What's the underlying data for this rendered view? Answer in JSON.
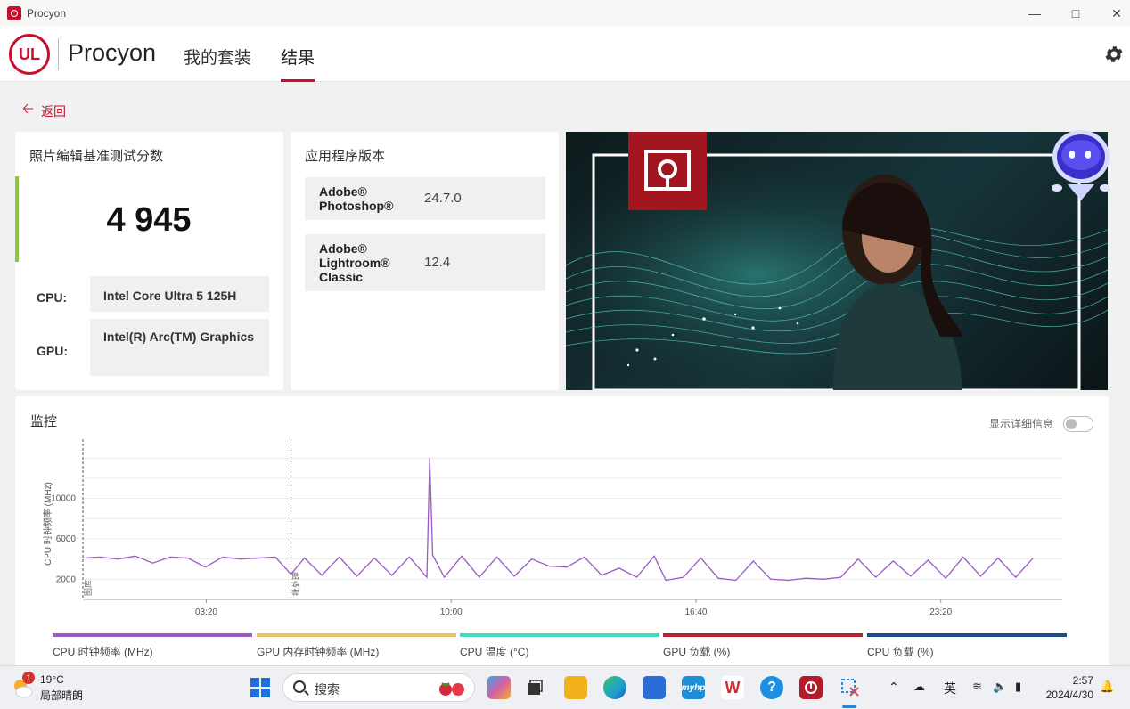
{
  "window": {
    "title": "Procyon"
  },
  "header": {
    "brand": "Procyon",
    "logo_text": "UL",
    "nav": [
      {
        "label": "我的套装",
        "active": false
      },
      {
        "label": "结果",
        "active": true
      }
    ]
  },
  "back_label": "返回",
  "score_card": {
    "title": "照片编辑基准测试分数",
    "score": "4 945",
    "cpu_label": "CPU:",
    "cpu_value": "Intel Core Ultra 5 125H",
    "gpu_label": "GPU:",
    "gpu_value": "Intel(R) Arc(TM) Graphics"
  },
  "app_card": {
    "title": "应用程序版本",
    "apps": [
      {
        "name": "Adobe® Photoshop®",
        "version": "24.7.0"
      },
      {
        "name": "Adobe® Lightroom® Classic",
        "version": "12.4"
      }
    ]
  },
  "monitor": {
    "title": "监控",
    "details_toggle_label": "显示详细信息",
    "details_toggle_on": false,
    "legend": [
      {
        "label": "CPU 时钟频率 (MHz)",
        "color": "#9b59c5"
      },
      {
        "label": "GPU 内存时钟频率 (MHz)",
        "color": "#e3c46a"
      },
      {
        "label": "CPU 温度 (°C)",
        "color": "#3fdcc0"
      },
      {
        "label": "GPU 负载 (%)",
        "color": "#b8222e"
      },
      {
        "label": "CPU 负载 (%)",
        "color": "#1b4a86"
      }
    ]
  },
  "chart_data": {
    "type": "line",
    "title": "",
    "ylabel": "CPU 时钟频率 (MHz)",
    "xlabel": "",
    "x_ticks": [
      "03:20",
      "10:00",
      "16:40",
      "23:20"
    ],
    "y_ticks": [
      2000,
      6000,
      10000
    ],
    "ylim": [
      0,
      15000
    ],
    "xlim": [
      0,
      1680
    ],
    "grid": true,
    "markers": [
      {
        "x": 0,
        "label": "图库"
      },
      {
        "x": 357,
        "label": "批处理"
      }
    ],
    "series": [
      {
        "name": "CPU 时钟频率 (MHz)",
        "color": "#9b59c5",
        "x": [
          0,
          30,
          60,
          90,
          120,
          150,
          180,
          210,
          240,
          270,
          300,
          330,
          357,
          380,
          410,
          440,
          470,
          500,
          530,
          560,
          590,
          595,
          600,
          620,
          650,
          680,
          710,
          740,
          770,
          800,
          830,
          860,
          890,
          920,
          950,
          980,
          1000,
          1030,
          1060,
          1090,
          1120,
          1150,
          1180,
          1210,
          1240,
          1270,
          1300,
          1330,
          1360,
          1390,
          1420,
          1450,
          1480,
          1510,
          1540,
          1570,
          1600,
          1630
        ],
        "values": [
          4100,
          4200,
          4000,
          4300,
          3600,
          4200,
          4100,
          3200,
          4200,
          4000,
          4100,
          4200,
          2500,
          4100,
          2400,
          4200,
          2300,
          4100,
          2400,
          4200,
          2200,
          14000,
          4400,
          2200,
          4300,
          2200,
          4200,
          2300,
          4000,
          3300,
          3200,
          4200,
          2400,
          3100,
          2200,
          4300,
          1900,
          2200,
          4100,
          2100,
          1900,
          3800,
          2000,
          1900,
          2100,
          2000,
          2200,
          4000,
          2200,
          3800,
          2300,
          3900,
          2100,
          4200,
          2300,
          4100,
          2200,
          4100
        ]
      }
    ]
  },
  "taskbar": {
    "weather_temp": "19°C",
    "weather_desc": "局部晴朗",
    "weather_badge": "1",
    "search_placeholder": "搜索",
    "ime": "英",
    "time": "2:57",
    "date": "2024/4/30",
    "apps": [
      {
        "icon": "windows-start-icon",
        "color": "#1e6fd9"
      },
      {
        "icon": "copilot-icon",
        "color": "#d25fa6"
      },
      {
        "icon": "task-view-icon",
        "color": "#333333"
      },
      {
        "icon": "file-explorer-icon",
        "color": "#f3b21b"
      },
      {
        "icon": "edge-icon",
        "color": "#1f9fd1"
      },
      {
        "icon": "store-icon",
        "color": "#2a6dd6"
      },
      {
        "icon": "myhp-icon",
        "color": "#1d8fd9"
      },
      {
        "icon": "wps-icon",
        "color": "#d7282f"
      },
      {
        "icon": "help-icon",
        "color": "#1a8fe3"
      },
      {
        "icon": "procyon-icon",
        "color": "#b31b2a"
      },
      {
        "icon": "snipping-tool-icon",
        "color": "#2b87d3"
      }
    ],
    "app_labels": {
      "myhp": "myhp",
      "wps": "W",
      "help": "?"
    }
  }
}
